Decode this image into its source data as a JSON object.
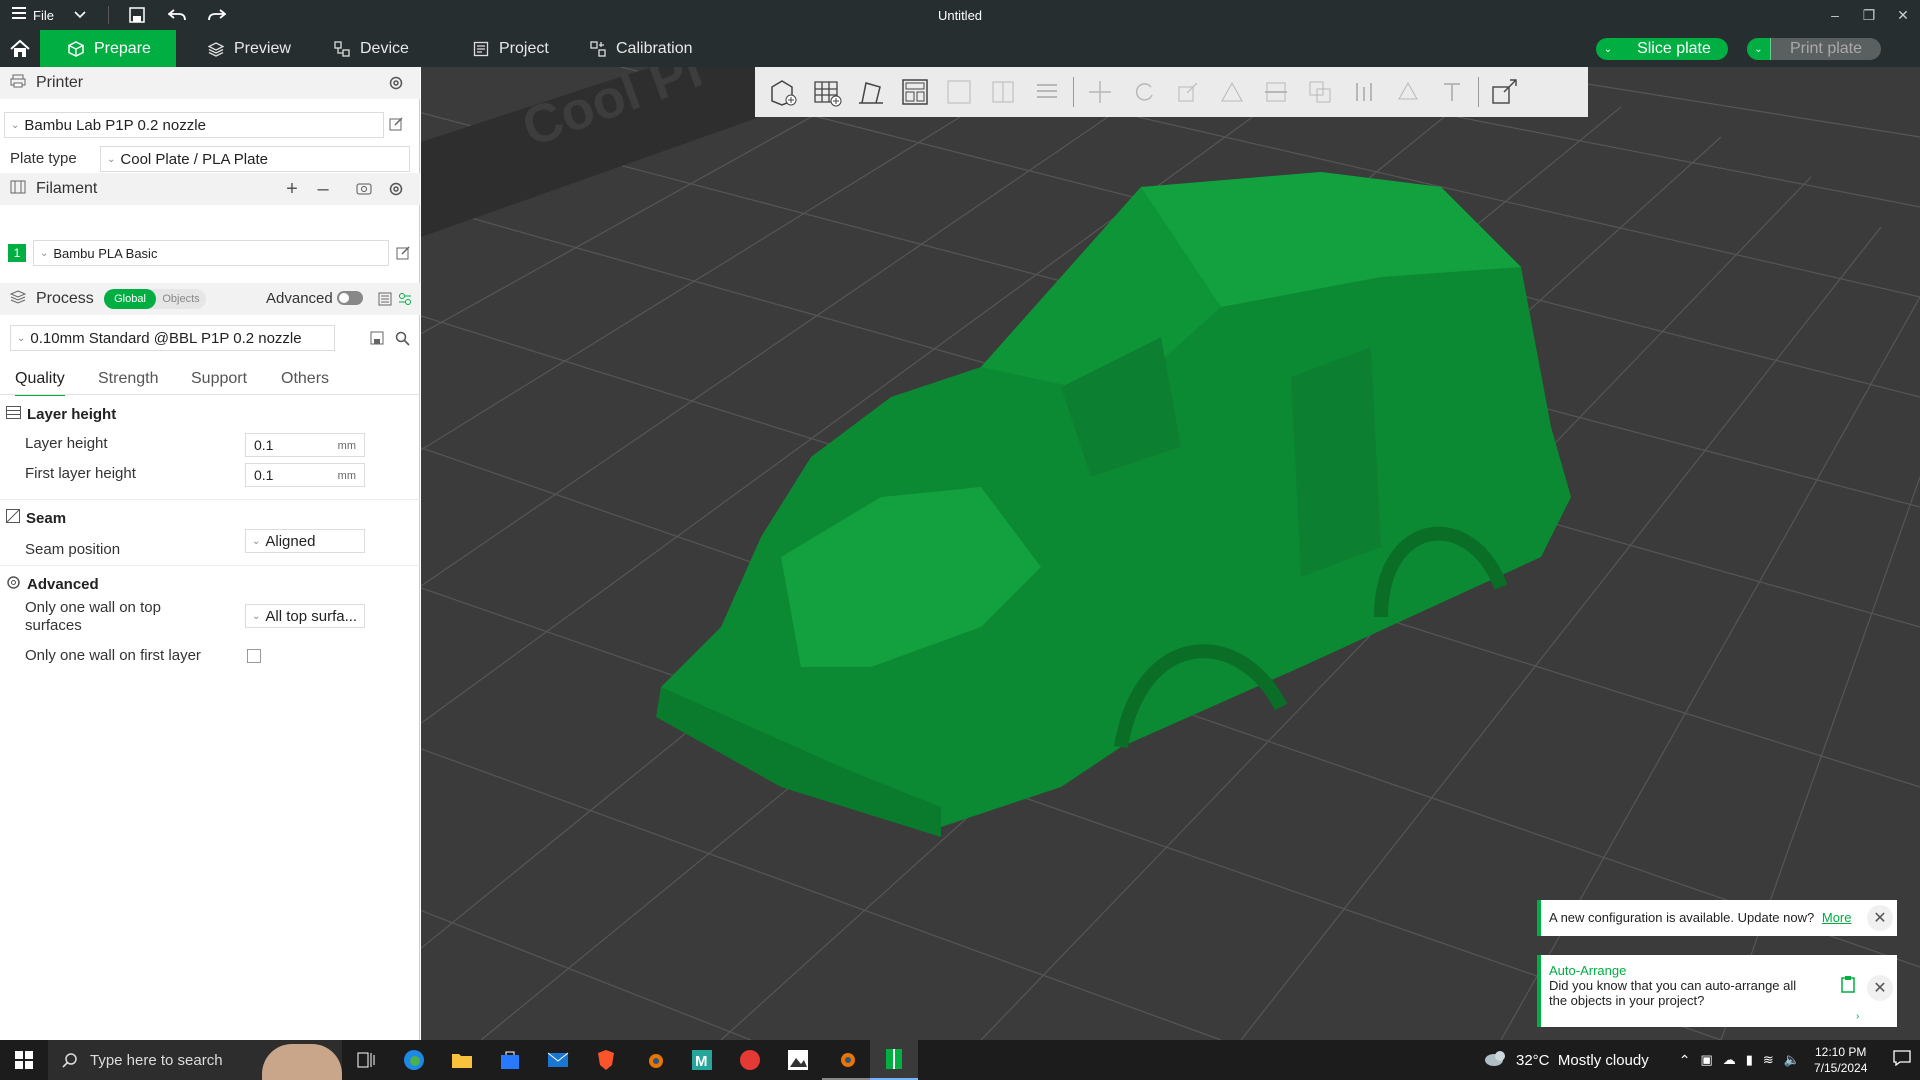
{
  "titlebar": {
    "file_label": "File",
    "window_title": "Untitled"
  },
  "tabs": [
    {
      "label": "Prepare",
      "active": true
    },
    {
      "label": "Preview",
      "active": false
    },
    {
      "label": "Device",
      "active": false
    },
    {
      "label": "Project",
      "active": false
    },
    {
      "label": "Calibration",
      "active": false
    }
  ],
  "actions": {
    "slice_label": "Slice plate",
    "print_label": "Print plate"
  },
  "printer": {
    "section_title": "Printer",
    "selected_printer": "Bambu Lab P1P 0.2 nozzle",
    "plate_type_label": "Plate type",
    "plate_type_value": "Cool Plate / PLA Plate"
  },
  "filament": {
    "section_title": "Filament",
    "slot_number": "1",
    "slot_color": "#00ae42",
    "selected_filament": "Bambu PLA Basic"
  },
  "process": {
    "section_title": "Process",
    "toggle_global": "Global",
    "toggle_objects": "Objects",
    "advanced_label": "Advanced",
    "advanced_on": false,
    "selected_profile": "0.10mm Standard @BBL P1P 0.2 nozzle",
    "tabs": [
      "Quality",
      "Strength",
      "Support",
      "Others"
    ],
    "active_tab": "Quality"
  },
  "quality": {
    "layer_height_group": "Layer height",
    "layer_height_label": "Layer height",
    "layer_height_value": "0.1",
    "layer_height_unit": "mm",
    "first_layer_label": "First layer height",
    "first_layer_value": "0.1",
    "first_layer_unit": "mm",
    "seam_group": "Seam",
    "seam_position_label": "Seam position",
    "seam_position_value": "Aligned",
    "advanced_group": "Advanced",
    "one_wall_top_label_line1": "Only one wall on top",
    "one_wall_top_label_line2": "surfaces",
    "one_wall_top_value": "All top surfa...",
    "one_wall_first_label": "Only one wall on first layer",
    "one_wall_first_checked": false
  },
  "viewport": {
    "bed_text": "Cool Pl",
    "model_color": "#0b8a33"
  },
  "notifications": {
    "update_text": "A new configuration is available. Update now?",
    "update_link": "More",
    "tip_title": "Auto-Arrange",
    "tip_line1": "Did you know that you can auto-arrange all",
    "tip_line2": "the objects in your project?"
  },
  "taskbar": {
    "search_placeholder": "Type here to search",
    "weather": "32°C  Mostly cloudy",
    "time": "12:10 PM",
    "date": "7/15/2024"
  },
  "colors": {
    "accent": "#00ae42",
    "titlebar_bg": "#262e30",
    "viewport_bg": "#3b3b3b"
  }
}
